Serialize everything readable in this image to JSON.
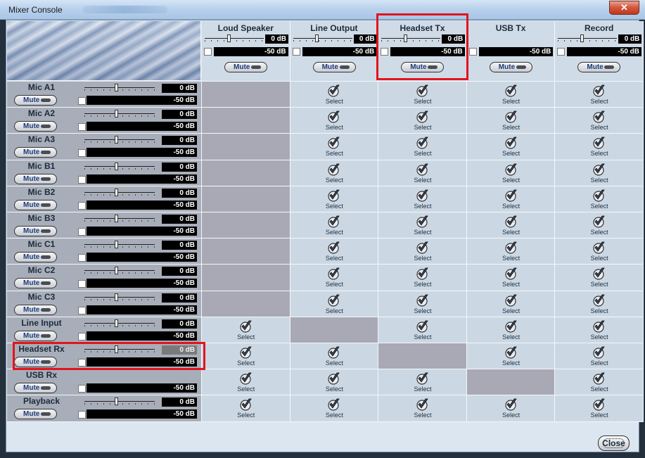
{
  "window": {
    "title": "Mixer Console",
    "close_glyph": "✕"
  },
  "columns": [
    {
      "name": "Loud Speaker",
      "has_slider": true,
      "top_value": "0 dB",
      "bottom_value": "-50 dB",
      "mute_label": "Mute"
    },
    {
      "name": "Line Output",
      "has_slider": true,
      "top_value": "0 dB",
      "bottom_value": "-50 dB",
      "mute_label": "Mute"
    },
    {
      "name": "Headset Tx",
      "has_slider": true,
      "top_value": "0 dB",
      "bottom_value": "-50 dB",
      "mute_label": "Mute",
      "highlighted": true
    },
    {
      "name": "USB Tx",
      "has_slider": false,
      "top_value": "",
      "bottom_value": "-50 dB",
      "mute_label": "Mute"
    },
    {
      "name": "Record",
      "has_slider": true,
      "top_value": "0 dB",
      "bottom_value": "-50 dB",
      "mute_label": "Mute"
    }
  ],
  "rows": [
    {
      "name": "Mic A1",
      "has_slider": true,
      "top_value": "0 dB",
      "bottom_value": "-50 dB",
      "mute_label": "Mute",
      "cells": [
        "blank",
        "select",
        "select",
        "select",
        "select"
      ]
    },
    {
      "name": "Mic A2",
      "has_slider": true,
      "top_value": "0 dB",
      "bottom_value": "-50 dB",
      "mute_label": "Mute",
      "cells": [
        "blank",
        "select",
        "select",
        "select",
        "select"
      ]
    },
    {
      "name": "Mic A3",
      "has_slider": true,
      "top_value": "0 dB",
      "bottom_value": "-50 dB",
      "mute_label": "Mute",
      "cells": [
        "blank",
        "select",
        "select",
        "select",
        "select"
      ]
    },
    {
      "name": "Mic B1",
      "has_slider": true,
      "top_value": "0 dB",
      "bottom_value": "-50 dB",
      "mute_label": "Mute",
      "cells": [
        "blank",
        "select",
        "select",
        "select",
        "select"
      ]
    },
    {
      "name": "Mic B2",
      "has_slider": true,
      "top_value": "0 dB",
      "bottom_value": "-50 dB",
      "mute_label": "Mute",
      "cells": [
        "blank",
        "select",
        "select",
        "select",
        "select"
      ]
    },
    {
      "name": "Mic B3",
      "has_slider": true,
      "top_value": "0 dB",
      "bottom_value": "-50 dB",
      "mute_label": "Mute",
      "cells": [
        "blank",
        "select",
        "select",
        "select",
        "select"
      ]
    },
    {
      "name": "Mic C1",
      "has_slider": true,
      "top_value": "0 dB",
      "bottom_value": "-50 dB",
      "mute_label": "Mute",
      "cells": [
        "blank",
        "select",
        "select",
        "select",
        "select"
      ]
    },
    {
      "name": "Mic C2",
      "has_slider": true,
      "top_value": "0 dB",
      "bottom_value": "-50 dB",
      "mute_label": "Mute",
      "cells": [
        "blank",
        "select",
        "select",
        "select",
        "select"
      ]
    },
    {
      "name": "Mic C3",
      "has_slider": true,
      "top_value": "0 dB",
      "bottom_value": "-50 dB",
      "mute_label": "Mute",
      "cells": [
        "blank",
        "select",
        "select",
        "select",
        "select"
      ]
    },
    {
      "name": "Line Input",
      "has_slider": true,
      "top_value": "0 dB",
      "bottom_value": "-50 dB",
      "mute_label": "Mute",
      "cells": [
        "select",
        "blank",
        "select",
        "select",
        "select"
      ]
    },
    {
      "name": "Headset Rx",
      "has_slider": true,
      "top_value": "0 dB",
      "bottom_value": "-50 dB",
      "mute_label": "Mute",
      "cells": [
        "select",
        "select",
        "blank",
        "select",
        "select"
      ],
      "highlighted": true,
      "top_dim": true
    },
    {
      "name": "USB Rx",
      "has_slider": false,
      "top_value": "",
      "bottom_value": "-50 dB",
      "mute_label": "Mute",
      "cells": [
        "select",
        "select",
        "select",
        "blank",
        "select"
      ]
    },
    {
      "name": "Playback",
      "has_slider": true,
      "top_value": "0 dB",
      "bottom_value": "-50 dB",
      "mute_label": "Mute",
      "cells": [
        "select",
        "select",
        "select",
        "select",
        "select"
      ]
    }
  ],
  "select_label": "Select",
  "select_icon": "checkmark-icon",
  "buttons": {
    "close": "Close"
  },
  "colors": {
    "highlight": "#e2141d",
    "blank_cell": "#a9a9b5",
    "active_cell": "#cbd8e4",
    "row_header": "#a8aeb9"
  }
}
